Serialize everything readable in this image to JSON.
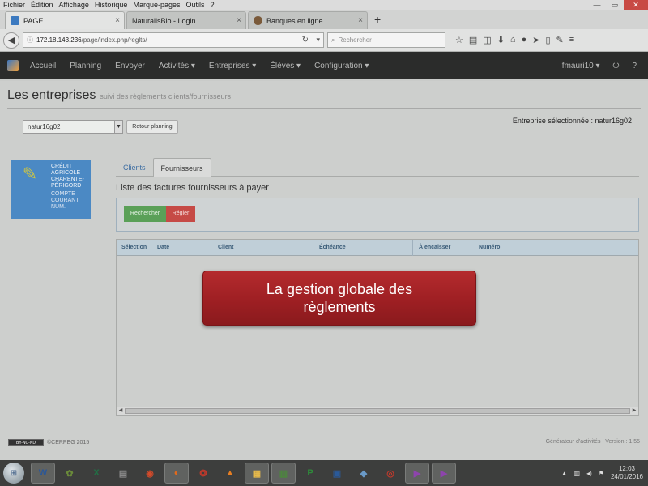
{
  "browser": {
    "menu": [
      "Fichier",
      "Édition",
      "Affichage",
      "Historique",
      "Marque-pages",
      "Outils",
      "?"
    ],
    "tabs": [
      {
        "label": "PAGE",
        "color": "#3c7ac0",
        "active": true
      },
      {
        "label": "NaturalisBio - Login",
        "color": "#888888",
        "active": false
      },
      {
        "label": "Banques en ligne",
        "color": "#7a5a3a",
        "active": false
      }
    ],
    "new_tab": "+",
    "url_host": "172.18.143.236",
    "url_path": "/page/index.php/reglts/",
    "search_placeholder": "Rechercher"
  },
  "app": {
    "nav": [
      "Accueil",
      "Planning",
      "Envoyer",
      "Activités ▾",
      "Entreprises ▾",
      "Élèves ▾",
      "Configuration ▾"
    ],
    "user": "fmauri10 ▾"
  },
  "page": {
    "title": "Les entreprises",
    "subtitle": "suivi des règlements clients/fournisseurs",
    "select_value": "natur16g02",
    "retour_label": "Retour planning",
    "selected_company": "Entreprise sélectionnée : natur16g02"
  },
  "bank": {
    "name_lines": [
      "Crédit",
      "Agricole",
      "Charente-",
      "Périgord"
    ],
    "account_lines": [
      "Compte",
      "courant",
      "Num."
    ]
  },
  "tabs": {
    "clients": "Clients",
    "fournisseurs": "Fournisseurs"
  },
  "list_title": "Liste des factures fournisseurs à payer",
  "buttons": {
    "rechercher": "Rechercher",
    "regler": "Régler"
  },
  "grid": {
    "columns": [
      "Sélection",
      "Date",
      "Client",
      "Échéance",
      "À encaisser",
      "Numéro"
    ]
  },
  "overlay": {
    "text": "La gestion globale des règlements"
  },
  "footer": {
    "cc": "BY-NC-ND",
    "left": "©CERPEG 2015",
    "right": "Générateur d'activités | Version : 1.55"
  },
  "taskbar": {
    "apps": [
      {
        "label": "W",
        "color": "#2b5797",
        "active": true
      },
      {
        "label": "✿",
        "color": "#6a8a3a"
      },
      {
        "label": "X",
        "color": "#207245"
      },
      {
        "label": "▤",
        "color": "#8a8a8a"
      },
      {
        "label": "◉",
        "color": "#d34a2a"
      },
      {
        "label": "◐",
        "color": "#e56a1a",
        "active": true
      },
      {
        "label": "❂",
        "color": "#c0392b"
      },
      {
        "label": "▲",
        "color": "#e67e22"
      },
      {
        "label": "▦",
        "color": "#e6b94a",
        "active": true
      },
      {
        "label": "▥",
        "color": "#4a8a3a",
        "active": true
      },
      {
        "label": "P",
        "color": "#2e8b3a"
      },
      {
        "label": "▣",
        "color": "#2a5a9a"
      },
      {
        "label": "◆",
        "color": "#6a9ac8"
      },
      {
        "label": "◎",
        "color": "#c0392b"
      },
      {
        "label": "▶",
        "color": "#8e44ad",
        "active": true
      },
      {
        "label": "▶",
        "color": "#8e44ad",
        "active": true
      }
    ],
    "time": "12:03",
    "date": "24/01/2016"
  }
}
